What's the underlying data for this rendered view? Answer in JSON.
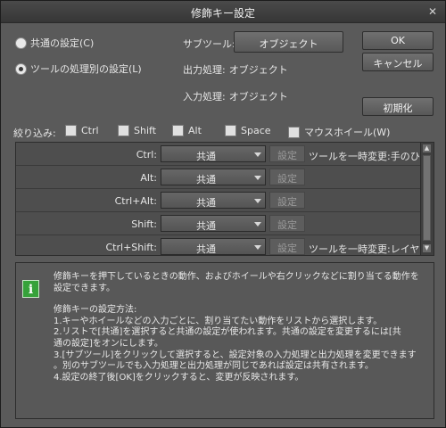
{
  "window": {
    "title": "修飾キー設定",
    "close_label": "✕"
  },
  "mode": {
    "common_label": "共通の設定(C)",
    "per_tool_label": "ツールの処理別の設定(L)"
  },
  "subtool": {
    "label": "サブツール:",
    "value": "オブジェクト",
    "output_label": "出力処理:",
    "output_value": "オブジェクト",
    "input_label": "入力処理:",
    "input_value": "オブジェクト"
  },
  "buttons": {
    "ok": "OK",
    "cancel": "キャンセル",
    "reset": "初期化"
  },
  "filter": {
    "label": "絞り込み:",
    "items": [
      "Ctrl",
      "Shift",
      "Alt",
      "Space",
      "マウスホイール(W)"
    ]
  },
  "table": {
    "setting_button": "設定",
    "rows": [
      {
        "key": "Ctrl:",
        "value": "共通",
        "desc": "ツールを一時変更:手のひら"
      },
      {
        "key": "Alt:",
        "value": "共通",
        "desc": ""
      },
      {
        "key": "Ctrl+Alt:",
        "value": "共通",
        "desc": ""
      },
      {
        "key": "Shift:",
        "value": "共通",
        "desc": ""
      },
      {
        "key": "Ctrl+Shift:",
        "value": "共通",
        "desc": "ツールを一時変更:レイヤー選択"
      }
    ]
  },
  "help": {
    "icon": "info-icon",
    "intro_1": "修飾キーを押下しているときの動作、およびホイールや右クリックなどに割り当てる動作を",
    "intro_2": "設定できます。",
    "heading": "修飾キーの設定方法:",
    "l1": "1.キーやホイールなどの入力ごとに、割り当てたい動作をリストから選択します。",
    "l2a": "2.リストで[共通]を選択すると共通の設定が使われます。共通の設定を変更するには[共",
    "l2b": "通の設定]をオンにします。",
    "l3a": "3.[サブツール]をクリックして選択すると、設定対象の入力処理と出力処理を変更できます",
    "l3b": "。別のサブツールでも入力処理と出力処理が同じであれば設定は共有されます。",
    "l4": "4.設定の終了後[OK]をクリックすると、変更が反映されます。"
  }
}
